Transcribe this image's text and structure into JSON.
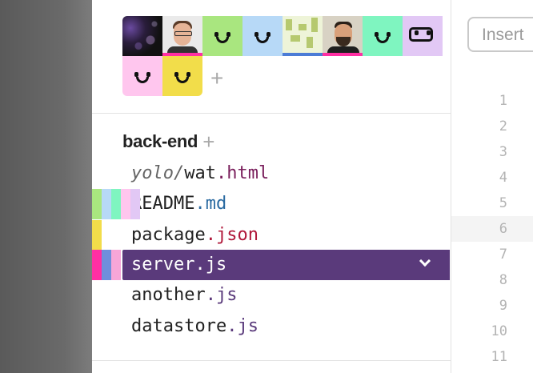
{
  "collaborators": {
    "avatars": [
      {
        "kind": "photo",
        "name_icon": "user-photo-avatar"
      },
      {
        "kind": "photo",
        "name_icon": "user-photo-avatar"
      },
      {
        "kind": "smiley",
        "color": "#a9e67f"
      },
      {
        "kind": "smiley",
        "color": "#b7d9f7"
      },
      {
        "kind": "pattern",
        "color": "#eef4d8"
      },
      {
        "kind": "photo",
        "name_icon": "user-photo-avatar"
      },
      {
        "kind": "smiley",
        "color": "#7ff5c0"
      },
      {
        "kind": "speaker",
        "color": "#e2c8f5"
      },
      {
        "kind": "smiley",
        "color": "#ffc6ee"
      },
      {
        "kind": "smiley",
        "color": "#f2dd4a"
      }
    ],
    "add_label": "+"
  },
  "folder": {
    "name": "back-end",
    "add_label": "+"
  },
  "files": [
    {
      "folder": "yolo/",
      "base": "wat",
      "ext": ".html",
      "ext_class": "ext-html"
    },
    {
      "folder": "",
      "base": "README",
      "ext": ".md",
      "ext_class": "ext-md"
    },
    {
      "folder": "",
      "base": "package",
      "ext": ".json",
      "ext_class": "ext-json"
    },
    {
      "folder": "",
      "base": "server",
      "ext": ".js",
      "ext_class": "ext-js",
      "selected": true
    },
    {
      "folder": "",
      "base": "another",
      "ext": ".js",
      "ext_class": "ext-js"
    },
    {
      "folder": "",
      "base": "datastore",
      "ext": ".js",
      "ext_class": "ext-js"
    }
  ],
  "presence_colors": {
    "readme": [
      "#a9e67f",
      "#b7d9f7",
      "#7ff5c0",
      "#ffc6ee",
      "#e2c8f5"
    ],
    "package": [
      "#f2dd4a"
    ],
    "server": [
      "#ff2fa3",
      "#6f8fdc",
      "#f7a6d8"
    ]
  },
  "editor": {
    "insert_label": "Insert",
    "line_numbers": [
      "1",
      "2",
      "3",
      "4",
      "5",
      "6",
      "7",
      "8",
      "9",
      "10",
      "11"
    ],
    "highlighted_line": "6"
  }
}
